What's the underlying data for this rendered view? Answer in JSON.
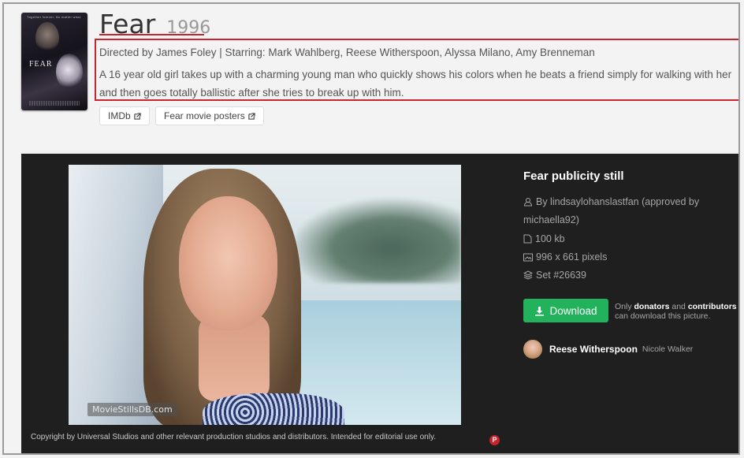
{
  "movie": {
    "title": "Fear",
    "year": "1996",
    "credits": "Directed by James Foley | Starring: Mark Wahlberg, Reese Witherspoon, Alyssa Milano, Amy Brenneman",
    "synopsis": "A 16 year old girl takes up with a charming young man who quickly shows his colors when he beats a friend simply for walking with her and then goes totally ballistic after she tries to break up with him."
  },
  "poster": {
    "tagline": "Together forever. No matter what.",
    "title": "FEAR"
  },
  "links": {
    "imdb_label": "IMDb",
    "posters_label": "Fear movie posters"
  },
  "photo": {
    "watermark": "MovieStillsDB.com",
    "copyright": "Copyright by Universal Studios and other relevant production studios and distributors. Intended for editorial use only."
  },
  "details": {
    "heading": "Fear publicity still",
    "uploader": "By lindsaylohanslastfan (approved by michaella92)",
    "filesize": "100 kb",
    "dimensions": "996 x 661 pixels",
    "set": "Set #26639",
    "download_label": "Download",
    "note_prefix": "Only",
    "note_donators": "donators",
    "note_and": "and",
    "note_contributors": "contributors",
    "note_suffix": "can download this picture."
  },
  "actor": {
    "name": "Reese Witherspoon",
    "role": "Nicole Walker"
  },
  "colors": {
    "accent_red": "#c8252e",
    "download_green": "#21b25b",
    "panel_bg": "#1f1f1f"
  },
  "icons": [
    "external-link-icon",
    "user-icon",
    "file-icon",
    "image-icon",
    "layers-icon",
    "download-icon",
    "pinterest-icon"
  ]
}
